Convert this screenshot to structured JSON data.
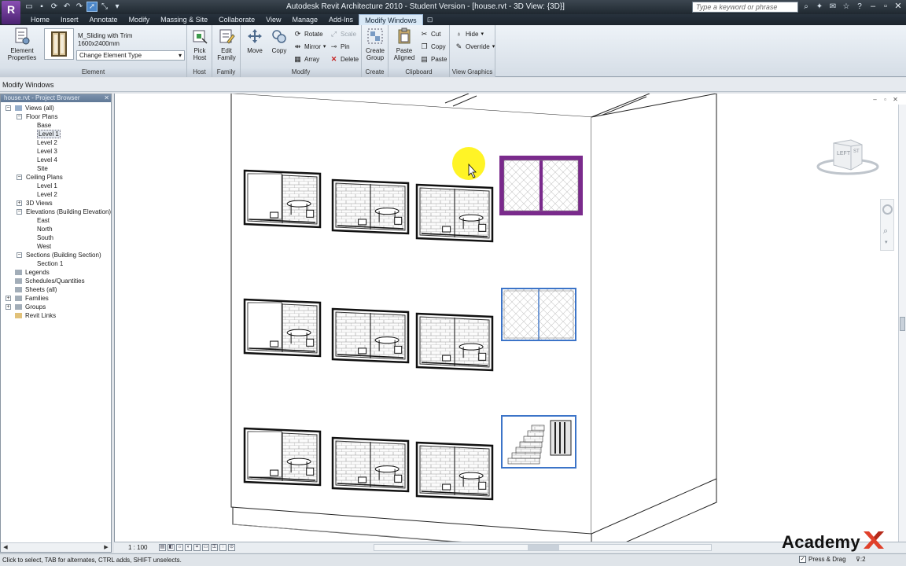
{
  "app": {
    "logo": "R",
    "window_title": "Autodesk Revit Architecture 2010 - Student Version - [house.rvt - 3D View: {3D}]",
    "search_placeholder": "Type a keyword or phrase"
  },
  "ribbon_tabs": [
    "Home",
    "Insert",
    "Annotate",
    "Modify",
    "Massing & Site",
    "Collaborate",
    "View",
    "Manage",
    "Add-Ins",
    "Modify Windows"
  ],
  "ribbon": {
    "element_panel": {
      "label": "Element",
      "properties_btn": "Element Properties",
      "type_name": "M_Sliding with Trim",
      "type_size": "1600x2400mm",
      "change_type": "Change Element Type"
    },
    "host_panel": {
      "label": "Host",
      "pick_host": "Pick Host"
    },
    "family_panel": {
      "label": "Family",
      "edit_family": "Edit Family"
    },
    "modify_panel": {
      "label": "Modify",
      "move": "Move",
      "copy": "Copy",
      "rotate": "Rotate",
      "mirror": "Mirror",
      "array": "Array",
      "scale": "Scale",
      "pin": "Pin",
      "delete": "Delete"
    },
    "create_panel": {
      "label": "Create",
      "create_group": "Create Group"
    },
    "clipboard_panel": {
      "label": "Clipboard",
      "paste_aligned": "Paste Aligned",
      "cut": "Cut",
      "copy": "Copy",
      "paste": "Paste"
    },
    "view_graphics_panel": {
      "label": "View Graphics",
      "hide": "Hide",
      "override": "Override"
    }
  },
  "options_bar": {
    "context": "Modify Windows"
  },
  "project_browser": {
    "title": "house.rvt - Project Browser",
    "tree": [
      {
        "label": "Views (all)",
        "level": 0,
        "toggle": "−",
        "icon": "views"
      },
      {
        "label": "Floor Plans",
        "level": 1,
        "toggle": "−"
      },
      {
        "label": "Base",
        "level": 2
      },
      {
        "label": "Level 1",
        "level": 2,
        "selected": true
      },
      {
        "label": "Level 2",
        "level": 2
      },
      {
        "label": "Level 3",
        "level": 2
      },
      {
        "label": "Level 4",
        "level": 2
      },
      {
        "label": "Site",
        "level": 2
      },
      {
        "label": "Ceiling Plans",
        "level": 1,
        "toggle": "−"
      },
      {
        "label": "Level 1",
        "level": 2
      },
      {
        "label": "Level 2",
        "level": 2
      },
      {
        "label": "3D Views",
        "level": 1,
        "toggle": "+"
      },
      {
        "label": "Elevations (Building Elevation)",
        "level": 1,
        "toggle": "−"
      },
      {
        "label": "East",
        "level": 2
      },
      {
        "label": "North",
        "level": 2
      },
      {
        "label": "South",
        "level": 2
      },
      {
        "label": "West",
        "level": 2
      },
      {
        "label": "Sections (Building Section)",
        "level": 1,
        "toggle": "−"
      },
      {
        "label": "Section 1",
        "level": 2
      },
      {
        "label": "Legends",
        "level": 0,
        "icon": "legend"
      },
      {
        "label": "Schedules/Quantities",
        "level": 0,
        "icon": "schedule"
      },
      {
        "label": "Sheets (all)",
        "level": 0,
        "icon": "sheet"
      },
      {
        "label": "Families",
        "level": 0,
        "toggle": "+",
        "icon": "family"
      },
      {
        "label": "Groups",
        "level": 0,
        "toggle": "+",
        "icon": "group"
      },
      {
        "label": "Revit Links",
        "level": 0,
        "icon": "link"
      }
    ]
  },
  "view_cube": {
    "face": "LEFT",
    "face2": "ST"
  },
  "view_control_bar": {
    "scale": "1 : 100"
  },
  "status": {
    "text": "Click to select, TAB for alternates, CTRL adds, SHIFT unselects.",
    "press_drag": "Press & Drag",
    "filter_count": "2"
  },
  "watermark": {
    "text": "Academy"
  },
  "colors": {
    "selected_window": "#7a2a8c",
    "highlight_window": "#3c74c8",
    "cursor_highlight": "#fff000"
  }
}
